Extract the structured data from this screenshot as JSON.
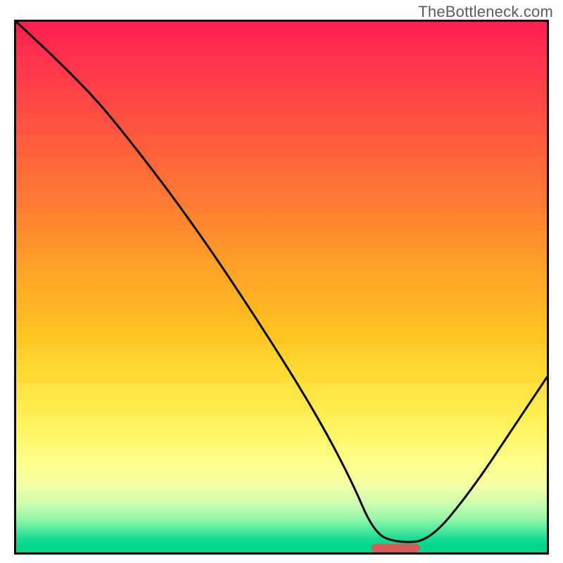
{
  "watermark": "TheBottleneck.com",
  "chart_data": {
    "type": "line",
    "title": "",
    "xlabel": "",
    "ylabel": "",
    "xlim": [
      0,
      100
    ],
    "ylim": [
      0,
      100
    ],
    "grid": false,
    "note": "Axes are unlabeled; values below are estimated from pixel positions on a 0–100 normalized scale (x left→right, y bottom→top).",
    "series": [
      {
        "name": "bottleneck-curve",
        "x": [
          0,
          12,
          22,
          34,
          46,
          56,
          63,
          67.5,
          72,
          78,
          86,
          94,
          100
        ],
        "values": [
          100,
          89,
          77,
          61,
          43,
          27,
          14,
          3.5,
          1.8,
          2.2,
          12,
          24,
          33
        ]
      }
    ],
    "marker": {
      "name": "optimal-range",
      "x_center": 71,
      "width": 9,
      "y": 1.6
    },
    "background_gradient": {
      "top_color": "#ff1e52",
      "bottom_color": "#00d68b",
      "meaning": "red = high bottleneck, green = low bottleneck"
    }
  }
}
